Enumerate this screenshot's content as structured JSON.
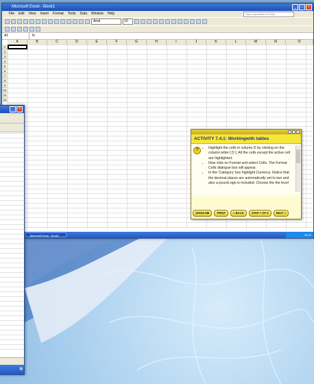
{
  "excel": {
    "title": "Microsoft Excel - Book1",
    "menu": [
      "File",
      "Edit",
      "View",
      "Insert",
      "Format",
      "Tools",
      "Data",
      "Window",
      "Help"
    ],
    "help_box_placeholder": "Type a question for help",
    "font_name": "Arial",
    "font_size": "10",
    "name_box": "A1",
    "columns": [
      "A",
      "B",
      "C",
      "D",
      "E",
      "F",
      "G",
      "H",
      "I",
      "J",
      "K",
      "L",
      "M",
      "N",
      "O"
    ],
    "rows": [
      "1",
      "2",
      "3",
      "4",
      "5",
      "6",
      "7",
      "8",
      "9",
      "10",
      "11",
      "12"
    ]
  },
  "activity": {
    "title": "ACTIVITY 7.4.1: Workingwith tables",
    "question_icon": "?",
    "bullets": [
      "Highlight the cells in column D by clicking on the column letter [ D ]. All the cells except the active cell are highlighted.",
      "Now click on Format and select Cells. The Format Cells dialogue box will appear.",
      "In the 'Category' box highlight Currency. Notice that the decimal places are automatically set to two and also a pound sign is included. Choose the the level"
    ],
    "buttons": {
      "show_me": "SHOW ME",
      "print": "PRINT",
      "back": "< BACK",
      "step": "STEP 7 OF 9",
      "next": "NEXT >"
    }
  },
  "taskbar": {
    "start": "start",
    "task_label": "Microsoft Excel - Book1",
    "clock": "09:20"
  },
  "left_window": {
    "taskbar_text": "N"
  }
}
